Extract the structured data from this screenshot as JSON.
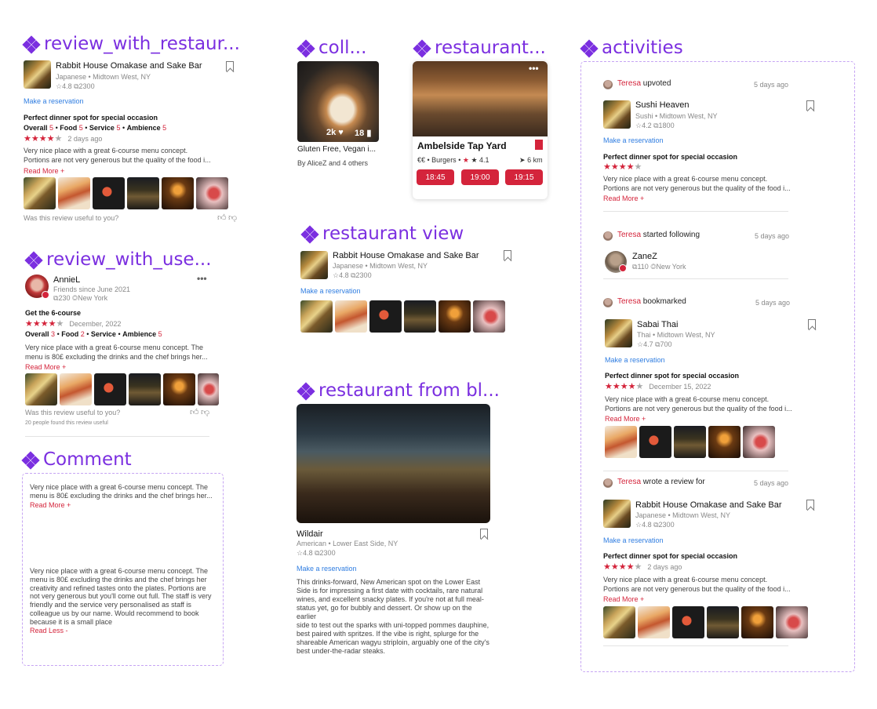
{
  "sections": {
    "review_restaurant": "review_with_restaur...",
    "collection": "coll...",
    "restaurant_card": "restaurant...",
    "activities": "activities",
    "review_user": "review_with_use...",
    "restaurant_view": "restaurant view",
    "comment": "Comment",
    "restaurant_blog": "restaurant from bl..."
  },
  "review1": {
    "name": "Rabbit House Omakase and Sake Bar",
    "cuisine": "Japanese • Midtown West, NY",
    "rating": "☆4.8",
    "reviews": "2300",
    "reservation": "Make a reservation",
    "title": "Perfect dinner spot for special occasion",
    "overall": "Overall",
    "overall_v": "5",
    "food": "Food",
    "food_v": "5",
    "service": "Service",
    "service_v": "5",
    "ambience": "Ambience",
    "ambience_v": "5",
    "stars": "★★★★",
    "stars_empty": "★",
    "date": "2 days ago",
    "text1": "Very nice place with a great 6-course menu concept.",
    "text2": "Portions are not very generous but the quality of the food i...",
    "read_more": "Read More +",
    "useful": "Was this review useful to you?"
  },
  "collection": {
    "likes": "2k ♥",
    "saves": "18",
    "title": "Gluten Free, Vegan i...",
    "by": "By AliceZ and 4 others"
  },
  "card": {
    "name": "Ambelside Tap Yard",
    "price": "€€",
    "category": "Burgers",
    "rating": "★ 4.1",
    "distance": "6 km",
    "times": [
      "18:45",
      "19:00",
      "19:15"
    ]
  },
  "review2": {
    "user": "AnnieL",
    "since": "Friends since June 2021",
    "count": "230",
    "location": "New York",
    "title": "Get the 6-course",
    "stars": "★★★★",
    "stars_empty": "★",
    "date": "December, 2022",
    "overall": "Overall",
    "overall_v": "3",
    "food": "Food",
    "food_v": "2",
    "service": "Service",
    "service_v": "",
    "ambience": "Ambience",
    "ambience_v": "5",
    "text1": "Very nice place with a great 6-course menu concept. The",
    "text2": "menu is 80£ excluding the drinks and the chef brings her...",
    "read_more": "Read More +",
    "useful": "Was this review useful to you?",
    "found": "20 people found this review useful"
  },
  "rview": {
    "name": "Rabbit House Omakase and Sake Bar",
    "cuisine": "Japanese • Midtown West, NY",
    "rating": "☆4.8",
    "reviews": "2300",
    "reservation": "Make a reservation"
  },
  "comment": {
    "c1_l1": "Very nice place with a great 6-course menu concept. The",
    "c1_l2": "menu is 80£ excluding the drinks and the chef brings her...",
    "c1_more": "Read More +",
    "c2_lines": [
      "Very nice place with a great 6-course menu concept. The",
      "menu is 80£ excluding the drinks and the chef brings her",
      "creativity and refined tastes onto the plates. Portions are",
      "not very generous but you'll come out full. The staff is very",
      "friendly and the service very personalised as staff is",
      "colleague us by our name. Would recommend to book",
      "because it is a small place"
    ],
    "c2_less": "Read Less -"
  },
  "blog": {
    "name": "Wildair",
    "cuisine": "American • Lower East Side, NY",
    "rating": "☆4.8",
    "reviews": "2300",
    "reservation": "Make a reservation",
    "lines": [
      "This drinks-forward, New American spot on the Lower East",
      "Side is for impressing a first date with cocktails, rare natural",
      "wines, and excellent snacky plates. If you're not at full meal-",
      "status yet, go for bubbly and dessert. Or show up on the earlier",
      "side to test out the sparks with uni-topped pommes dauphine,",
      "best paired with spritzes. If the vibe is right, splurge for the",
      "shareable American wagyu striploin, arguably one of the city's",
      "best under-the-radar steaks."
    ]
  },
  "activities": {
    "a1": {
      "user": "Teresa",
      "action": "upvoted",
      "time": "5 days ago",
      "name": "Sushi Heaven",
      "cuisine": "Sushi • Midtown West, NY",
      "rating": "☆4.2",
      "reviews": "1800",
      "reservation": "Make a reservation",
      "title": "Perfect dinner spot for special occasion",
      "stars": "★★★★",
      "stars_empty": "★",
      "text1": "Very nice place with a great 6-course menu concept.",
      "text2": "Portions are not very generous but the quality of the food i...",
      "read_more": "Read More +"
    },
    "a2": {
      "user": "Teresa",
      "action": "started following",
      "time": "5 days ago",
      "name": "ZaneZ",
      "count": "110",
      "location": "New York"
    },
    "a3": {
      "user": "Teresa",
      "action": "bookmarked",
      "time": "5 days ago",
      "name": "Sabai Thai",
      "cuisine": "Thai • Midtown West, NY",
      "rating": "☆4.7",
      "reviews": "700",
      "reservation": "Make a reservation",
      "title": "Perfect dinner spot for special occasion",
      "stars": "★★★★",
      "stars_empty": "★",
      "date": "December 15, 2022",
      "text1": "Very nice place with a great 6-course menu concept.",
      "text2": "Portions are not very generous but the quality of the food i...",
      "read_more": "Read More +"
    },
    "a4": {
      "user": "Teresa",
      "action": "wrote a review for",
      "time": "5 days ago",
      "name": "Rabbit House Omakase and Sake Bar",
      "cuisine": "Japanese • Midtown West, NY",
      "rating": "☆4.8",
      "reviews": "2300",
      "reservation": "Make a reservation",
      "title": "Perfect dinner spot for special occasion",
      "stars": "★★★★",
      "stars_empty": "★",
      "date": "2 days ago",
      "text1": "Very nice place with a great 6-course menu concept.",
      "text2": "Portions are not very generous but the quality of the food i...",
      "read_more": "Read More +"
    }
  }
}
